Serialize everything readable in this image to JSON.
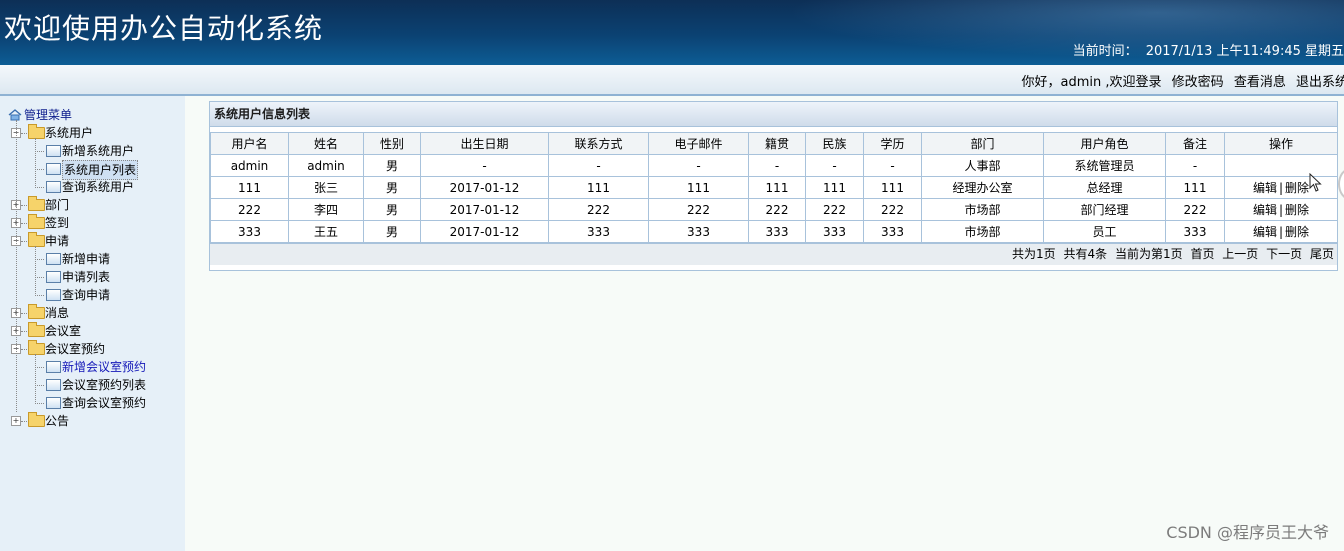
{
  "header": {
    "title": "欢迎使用办公自动化系统",
    "clock_label": "当前时间：",
    "clock_value": "2017/1/13 上午11:49:45 星期五"
  },
  "userbar": {
    "greeting": "你好，admin ,欢迎登录",
    "change_password": "修改密码",
    "view_messages": "查看消息",
    "logout": "退出系统"
  },
  "sidebar": {
    "root": "管理菜单",
    "groups": [
      {
        "label": "系统用户",
        "expanded": true,
        "items": [
          "新增系统用户",
          "系统用户列表",
          "查询系统用户"
        ]
      },
      {
        "label": "部门",
        "expanded": false,
        "items": []
      },
      {
        "label": "签到",
        "expanded": false,
        "items": []
      },
      {
        "label": "申请",
        "expanded": true,
        "items": [
          "新增申请",
          "申请列表",
          "查询申请"
        ]
      },
      {
        "label": "消息",
        "expanded": false,
        "items": []
      },
      {
        "label": "会议室",
        "expanded": false,
        "items": []
      },
      {
        "label": "会议室预约",
        "expanded": true,
        "items": [
          "新增会议室预约",
          "会议室预约列表",
          "查询会议室预约"
        ]
      },
      {
        "label": "公告",
        "expanded": false,
        "items": []
      }
    ]
  },
  "panel": {
    "title": "系统用户信息列表",
    "columns": [
      "用户名",
      "姓名",
      "性别",
      "出生日期",
      "联系方式",
      "电子邮件",
      "籍贯",
      "民族",
      "学历",
      "部门",
      "用户角色",
      "备注",
      "操作"
    ],
    "rows": [
      [
        "admin",
        "admin",
        "男",
        "-",
        "-",
        "-",
        "-",
        "-",
        "-",
        "人事部",
        "系统管理员",
        "-",
        ""
      ],
      [
        "111",
        "张三",
        "男",
        "2017-01-12",
        "111",
        "111",
        "111",
        "111",
        "111",
        "经理办公室",
        "总经理",
        "111",
        "edit"
      ],
      [
        "222",
        "李四",
        "男",
        "2017-01-12",
        "222",
        "222",
        "222",
        "222",
        "222",
        "市场部",
        "部门经理",
        "222",
        "edit"
      ],
      [
        "333",
        "王五",
        "男",
        "2017-01-12",
        "333",
        "333",
        "333",
        "333",
        "333",
        "市场部",
        "员工",
        "333",
        "edit"
      ]
    ],
    "edit_label": "编辑",
    "separator": "|",
    "delete_label": "删除",
    "pager": {
      "total_pages": "共为1页",
      "total_records": "共有4条",
      "current_page": "当前为第1页",
      "first": "首页",
      "prev": "上一页",
      "next": "下一页",
      "last": "尾页"
    }
  },
  "watermark": "CSDN @程序员王大爷",
  "colors": {
    "banner_top": "#0d2f56",
    "banner_bottom": "#0d5d95",
    "grid_border": "#a8c2db",
    "sidebar_bg": "#e6f0f8",
    "link_blue": "#1418b8"
  }
}
